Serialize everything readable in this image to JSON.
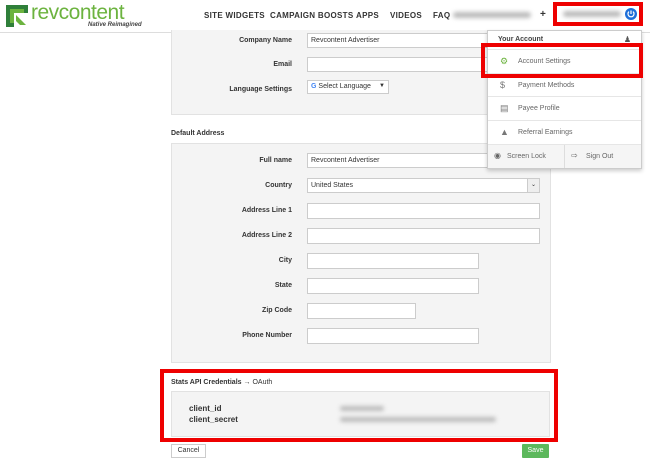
{
  "brand": {
    "name": "revcontent",
    "tagline": "Native Reimagined",
    "accent": "#6cb33f"
  },
  "nav": {
    "items": [
      "SITE WIDGETS",
      "CAMPAIGN BOOSTS",
      "APPS",
      "VIDEOS",
      "FAQ"
    ],
    "plus": "+"
  },
  "account_form": {
    "company_name_label": "Company Name",
    "company_name_value": "Revcontent Advertiser",
    "email_label": "Email",
    "language_label": "Language Settings",
    "language_value": "Select Language"
  },
  "address": {
    "title": "Default Address",
    "full_name_label": "Full name",
    "full_name_value": "Revcontent Advertiser",
    "country_label": "Country",
    "country_value": "United States",
    "address1_label": "Address Line 1",
    "address2_label": "Address Line 2",
    "city_label": "City",
    "state_label": "State",
    "zip_label": "Zip Code",
    "phone_label": "Phone Number"
  },
  "api": {
    "title": "Stats API Credentials",
    "arrow": "→",
    "suffix": "OAuth",
    "client_id_label": "client_id",
    "client_secret_label": "client_secret"
  },
  "buttons": {
    "cancel": "Cancel",
    "save": "Save"
  },
  "dropdown": {
    "header": "Your Account",
    "items": [
      {
        "label": "Account Settings",
        "icon": "gear-icon"
      },
      {
        "label": "Payment Methods",
        "icon": "dollar-icon"
      },
      {
        "label": "Payee Profile",
        "icon": "document-icon"
      },
      {
        "label": "Referral Earnings",
        "icon": "megaphone-icon"
      }
    ],
    "screen_lock": "Screen Lock",
    "sign_out": "Sign Out"
  },
  "colors": {
    "highlight": "#e00000",
    "save": "#5cb85c"
  }
}
